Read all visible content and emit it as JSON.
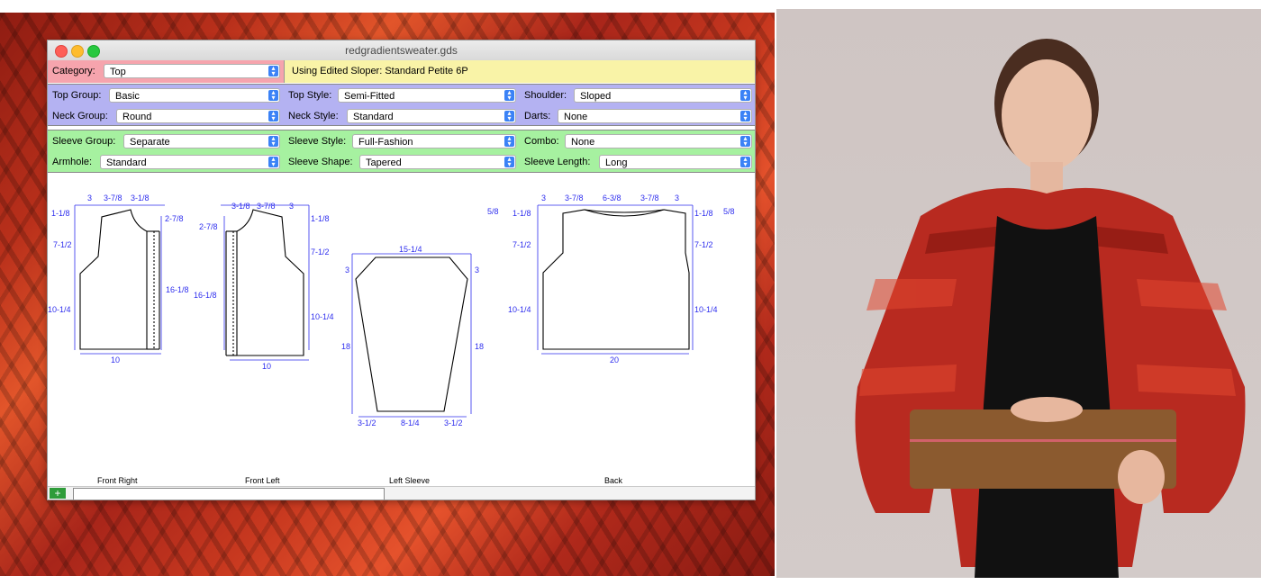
{
  "window": {
    "title": "redgradientsweater.gds"
  },
  "row_category": {
    "category_label": "Category:",
    "category_value": "Top",
    "sloper_text": "Using Edited Sloper:  Standard Petite 6P"
  },
  "row_top": {
    "top_group_label": "Top Group:",
    "top_group_value": "Basic",
    "top_style_label": "Top Style:",
    "top_style_value": "Semi-Fitted",
    "shoulder_label": "Shoulder:",
    "shoulder_value": "Sloped",
    "neck_group_label": "Neck Group:",
    "neck_group_value": "Round",
    "neck_style_label": "Neck Style:",
    "neck_style_value": "Standard",
    "darts_label": "Darts:",
    "darts_value": "None"
  },
  "row_sleeve": {
    "sleeve_group_label": "Sleeve Group:",
    "sleeve_group_value": "Separate",
    "sleeve_style_label": "Sleeve Style:",
    "sleeve_style_value": "Full-Fashion",
    "combo_label": "Combo:",
    "combo_value": "None",
    "armhole_label": "Armhole:",
    "armhole_value": "Standard",
    "sleeve_shape_label": "Sleeve Shape:",
    "sleeve_shape_value": "Tapered",
    "sleeve_length_label": "Sleeve Length:",
    "sleeve_length_value": "Long"
  },
  "schematics": {
    "front_right": {
      "caption": "Front Right",
      "top_dims": [
        "3",
        "3-7/8",
        "3-1/8"
      ],
      "left_dims": [
        "1-1/8",
        "7-1/2",
        "10-1/4"
      ],
      "right_dims": [
        "2-7/8",
        "16-1/8"
      ],
      "bottom": "10"
    },
    "front_left": {
      "caption": "Front Left",
      "top_dims": [
        "3-1/8",
        "3-7/8",
        "3"
      ],
      "left_dims": [
        "2-7/8",
        "16-1/8"
      ],
      "right_dims": [
        "1-1/8",
        "7-1/2",
        "10-1/4"
      ],
      "bottom": "10"
    },
    "left_sleeve": {
      "caption": "Left Sleeve",
      "top": "15-1/4",
      "side_top": "3",
      "side": "18",
      "bottom_dims": [
        "3-1/2",
        "8-1/4",
        "3-1/2"
      ]
    },
    "back": {
      "caption": "Back",
      "top_dims": [
        "3",
        "3-7/8",
        "6-3/8",
        "3-7/8",
        "3"
      ],
      "left_dims": [
        "5/8",
        "1-1/8",
        "7-1/2",
        "10-1/4"
      ],
      "right_dims": [
        "1-1/8",
        "5/8",
        "7-1/2",
        "10-1/4"
      ],
      "bottom": "20"
    }
  },
  "bottombar": {
    "plus_label": "+"
  },
  "colors": {
    "category_row": "#f6a4ad",
    "sloper_row": "#f9f3a7",
    "top_rows": "#b4b2f2",
    "sleeve_rows": "#a6f1a0",
    "dimension_lines": "#2e2eee"
  }
}
